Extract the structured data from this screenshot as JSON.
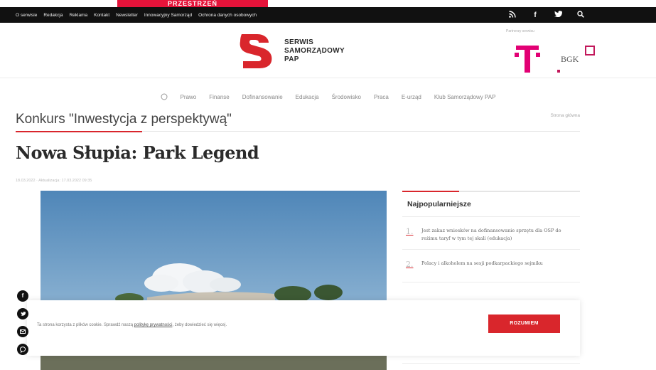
{
  "promo": {
    "text": "PRZESTRZEŃ"
  },
  "topbar": {
    "links": [
      "O serwisie",
      "Redakcja",
      "Reklama",
      "Kontakt",
      "Newsletter",
      "Innowacyjny Samorząd",
      "Ochrona danych osobowych"
    ],
    "icons": [
      "rss-icon",
      "facebook-icon",
      "twitter-icon",
      "search-icon"
    ]
  },
  "header": {
    "logo_lines": [
      "SERWIS",
      "SAMORZĄDOWY",
      "PAP"
    ],
    "partners_label": "Partnerzy serwisu",
    "bgk_label": "BGK",
    "brand_colors": {
      "red": "#d9262c",
      "telekom": "#e20074",
      "bgk": "#c2185b"
    }
  },
  "nav": {
    "items": [
      "Prawo",
      "Finanse",
      "Dofinansowanie",
      "Edukacja",
      "Środowisko",
      "Praca",
      "E-urząd",
      "Klub Samorządowy PAP"
    ]
  },
  "section": {
    "title": "Konkurs \"Inwestycja z perspektywą\"",
    "crumb": "Strona główna"
  },
  "article": {
    "headline": "Nowa Słupia: Park Legend",
    "meta": "18.03.2022 · Aktualizacja: 17.03.2022 09:35"
  },
  "sidebar": {
    "heading": "Najpopularniejsze",
    "items": [
      {
        "num": "1.",
        "text": "Jest zakaz wniosków na dofinansowanie sprzętu dla OSP do reżimu taryf w tym tej skali (edukacja)"
      },
      {
        "num": "2.",
        "text": "Polacy i alkoholem na sesji podkarpackiego sejmiku"
      }
    ]
  },
  "social": [
    "facebook",
    "twitter",
    "email",
    "messenger"
  ],
  "cookie": {
    "message_before": "Ta strona korzysta z plików cookie. Sprawdź naszą",
    "link": "politykę prywatności",
    "message_after": ", żeby dowiedzieć się więcej.",
    "accept": "ROZUMIEM"
  }
}
